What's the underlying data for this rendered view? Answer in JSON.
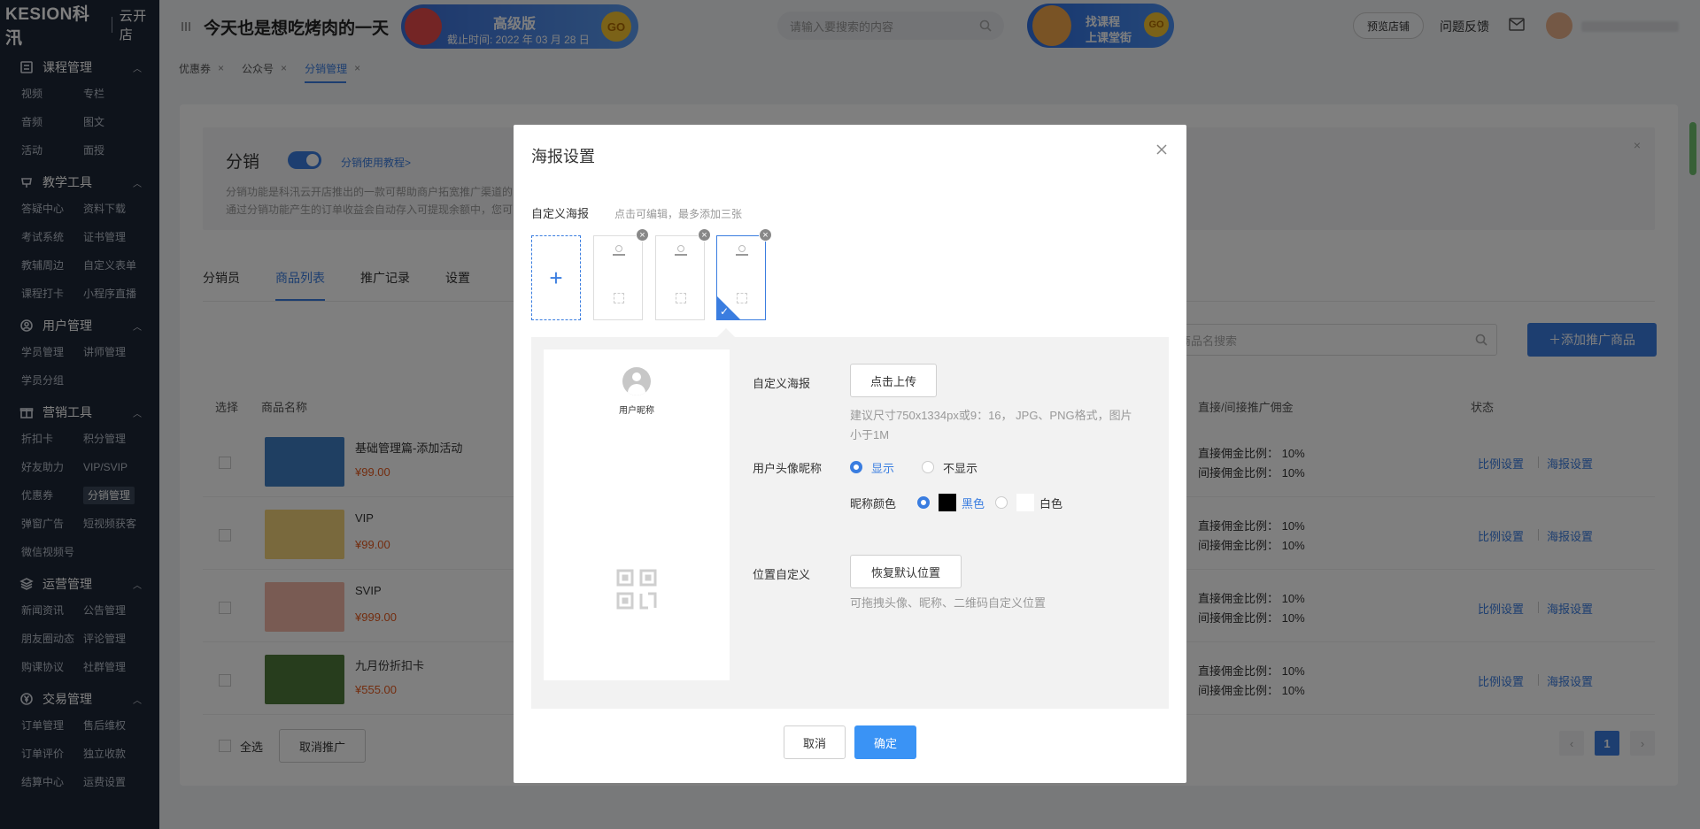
{
  "sidebar": {
    "brand": "KESION科汛",
    "shop": "云开店",
    "groups": [
      {
        "title": "课程管理",
        "icon": "course-icon",
        "items": [
          "视频",
          "专栏",
          "音频",
          "图文",
          "活动",
          "面授"
        ]
      },
      {
        "title": "教学工具",
        "icon": "teaching-icon",
        "items": [
          "答疑中心",
          "资料下载",
          "考试系统",
          "证书管理",
          "教辅周边",
          "自定义表单",
          "课程打卡",
          "小程序直播"
        ]
      },
      {
        "title": "用户管理",
        "icon": "user-icon",
        "items": [
          "学员管理",
          "讲师管理",
          "学员分组"
        ]
      },
      {
        "title": "营销工具",
        "icon": "gift-icon",
        "items": [
          "折扣卡",
          "积分管理",
          "好友助力",
          "VIP/SVIP",
          "优惠券",
          "分销管理",
          "弹窗广告",
          "短视频获客",
          "微信视频号"
        ]
      },
      {
        "title": "运营管理",
        "icon": "layers-icon",
        "items": [
          "新闻资讯",
          "公告管理",
          "朋友圈动态",
          "评论管理",
          "购课协议",
          "社群管理"
        ]
      },
      {
        "title": "交易管理",
        "icon": "yen-icon",
        "items": [
          "订单管理",
          "售后维权",
          "订单评价",
          "独立收款",
          "结算中心",
          "运费设置"
        ]
      }
    ],
    "active_item": "分销管理"
  },
  "header": {
    "site_title": "今天也是想吃烤肉的一天",
    "pro_level": "高级版",
    "expire": "截止时间: 2022 年 03 月 28 日",
    "go": "GO",
    "search_placeholder": "请输入要搜索的内容",
    "course_banner_line1": "找课程",
    "course_banner_line2": "上课堂街",
    "preview": "预览店铺",
    "feedback": "问题反馈"
  },
  "page_tabs": [
    {
      "label": "优惠券",
      "active": false
    },
    {
      "label": "公众号",
      "active": false
    },
    {
      "label": "分销管理",
      "active": true
    }
  ],
  "notice": {
    "title": "分销",
    "link": "分销使用教程>",
    "line1": "分销功能是科汛云开店推出的一款可帮助商户拓宽推广渠道的",
    "line2": "通过分销功能产生的订单收益会自动存入可提现余额中，您可"
  },
  "content_tabs": [
    "分销员",
    "商品列表",
    "推广记录",
    "设置"
  ],
  "goods_search_placeholder": "商品名搜索",
  "add_goods": "添加推广商品",
  "table": {
    "headers": [
      "选择",
      "商品名称",
      "直接/间接推广佣金",
      "状态"
    ],
    "rows": [
      {
        "name": "基础管理篇-添加活动",
        "price": "¥99.00",
        "direct": "直接佣金比例： 10%",
        "indirect": "间接佣金比例： 10%",
        "thumb": "#3f7fc4"
      },
      {
        "name": "VIP",
        "price": "¥99.00",
        "direct": "直接佣金比例： 10%",
        "indirect": "间接佣金比例： 10%",
        "thumb": "#f3d27a"
      },
      {
        "name": "SVIP",
        "price": "¥999.00",
        "direct": "直接佣金比例： 10%",
        "indirect": "间接佣金比例： 10%",
        "thumb": "#f2b7a6"
      },
      {
        "name": "九月份折扣卡",
        "price": "¥555.00",
        "direct": "直接佣金比例： 10%",
        "indirect": "间接佣金比例： 10%",
        "thumb": "#4f7a3a"
      }
    ],
    "action_ratio": "比例设置",
    "action_poster": "海报设置"
  },
  "footer": {
    "select_all": "全选",
    "cancel_promo": "取消推广",
    "page": "1",
    "prev": "‹",
    "next": "›"
  },
  "modal": {
    "title": "海报设置",
    "custom_label": "自定义海报",
    "custom_hint": "点击可编辑，最多添加三张",
    "add": "+",
    "nickname_preview": "用户昵称",
    "field_poster": "自定义海报",
    "upload": "点击上传",
    "upload_hint": "建议尺寸750x1334px或9：16， JPG、PNG格式，图片小于1M",
    "field_avatar": "用户头像昵称",
    "show": "显示",
    "hide": "不显示",
    "nick_color": "昵称颜色",
    "black": "黑色",
    "white": "白色",
    "field_position": "位置自定义",
    "reset": "恢复默认位置",
    "position_hint": "可拖拽头像、昵称、二维码自定义位置",
    "cancel": "取消",
    "ok": "确定"
  }
}
